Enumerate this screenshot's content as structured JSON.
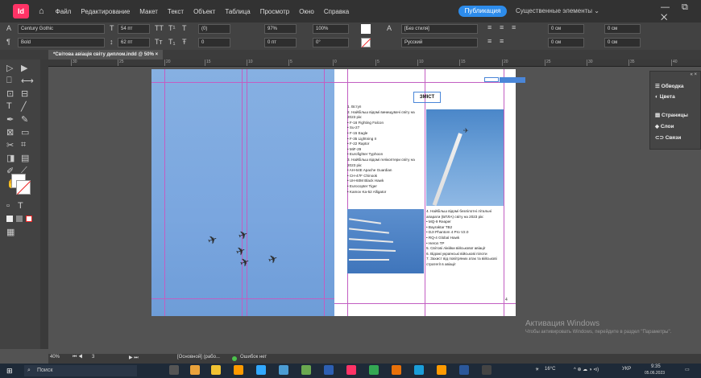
{
  "menubar": {
    "logo": "Id",
    "home_icon": "home-icon",
    "items": [
      "Файл",
      "Редактирование",
      "Макет",
      "Текст",
      "Объект",
      "Таблица",
      "Просмотр",
      "Окно",
      "Справка"
    ],
    "publish_label": "Публикация",
    "workspace_label": "Существенные элементы ⌄",
    "window_controls": "— ⧉ ✕"
  },
  "control": {
    "font": "Century Gothic",
    "style": "Bold",
    "size": "54 пт",
    "leading": "62 пт",
    "tracking": "(0)",
    "kerning": "0",
    "vscale": "97%",
    "hscale": "100%",
    "baseline": "0 пт",
    "skew": "0°",
    "char_style": "[Без стиля]",
    "language": "Русский",
    "indent1": "0 см",
    "indent2": "0 см",
    "indent3": "0 см",
    "indent4": "0 см"
  },
  "doc_tab": "*Світова авіація світу диплом.indd @ 50%",
  "ruler_labels": [
    "30",
    "25",
    "20",
    "15",
    "10",
    "5",
    "0",
    "5",
    "10",
    "15",
    "20",
    "25",
    "30",
    "35",
    "40"
  ],
  "page_right": {
    "title": "ЗМІСТ",
    "toc_part1": [
      "1. Вступ",
      "2. Найбільш відомі винищувачі світу на 2023 рік:",
      "• F-16 Fighting Falcon",
      "• Su-27",
      "• F-15 Eagle",
      "• F-35 Lightning II",
      "• F-22 Raptor",
      "• MiF-29",
      "• Eurofighter Typhoon",
      "3. Найбільш відомі гелікоптери світу на 2023 рік:",
      "• AH-64E Apache Guardian",
      "• CH-47F Chinook",
      "• UH-60M Black Hawk",
      "• Eurocopter Tiger",
      "• Kamov Ka-52 Alligator"
    ],
    "toc_part2": [
      "4. Найбільш відомі безпілотні літальні апарати (БПЛА) світу на 2023 рік:",
      "• MQ-9 Reaper",
      "• Bayraktar TB2",
      "• DJI Phantom 4 Pro V2.0",
      "• RQ-4 Global Hawk",
      "• Heron TP",
      "5. Світові лінійки військової авіації",
      "6. Відомі українські військові пілоти",
      "7. Захист від повітряних атак та військові стратегії в авіації"
    ],
    "page_number": "4"
  },
  "panel": {
    "items": [
      {
        "icon": "stroke-icon",
        "label": "Обводка"
      },
      {
        "icon": "swatches-icon",
        "label": "Цвета"
      },
      {
        "icon": "pages-icon",
        "label": "Страницы"
      },
      {
        "icon": "layers-icon",
        "label": "Слои"
      },
      {
        "icon": "links-icon",
        "label": "Связи"
      }
    ]
  },
  "status": {
    "zoom": "40%",
    "page": "3",
    "master": "[Основной] (рабо...",
    "errors": "Ошибок нет"
  },
  "watermark": {
    "title": "Активация Windows",
    "subtitle": "Чтобы активировать Windows, перейдите в раздел \"Параметры\"."
  },
  "taskbar": {
    "search_placeholder": "Поиск",
    "weather": "16°C",
    "lang": "УКР",
    "time": "9:35",
    "date": "05.06.2023"
  }
}
